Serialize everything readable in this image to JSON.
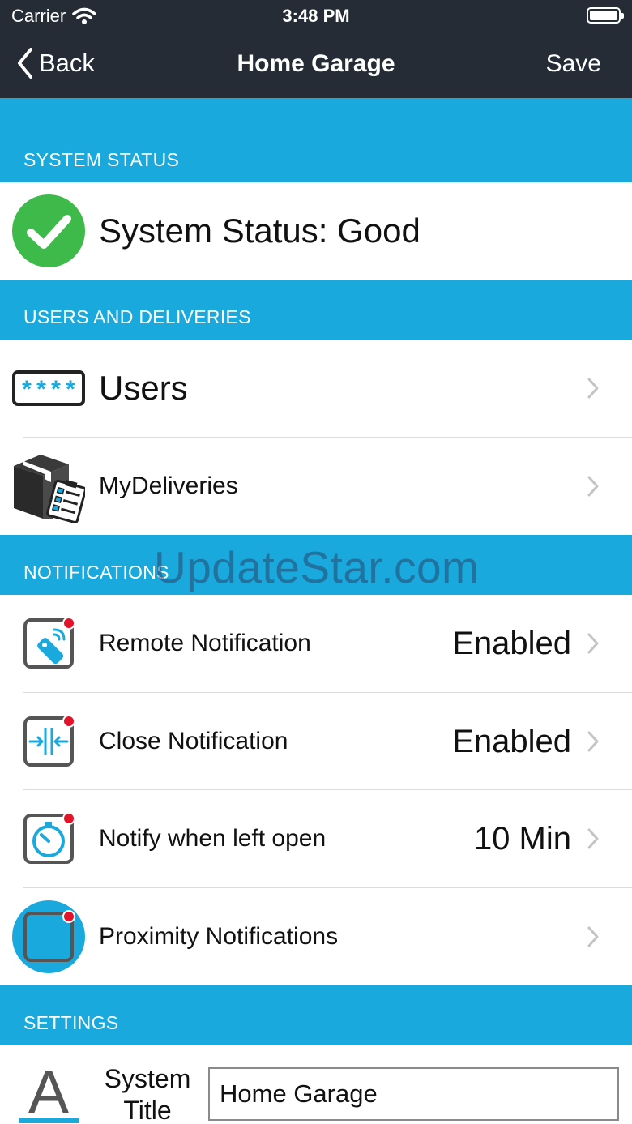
{
  "status_bar": {
    "carrier": "Carrier",
    "time": "3:48 PM"
  },
  "nav": {
    "back_label": "Back",
    "title": "Home Garage",
    "save_label": "Save"
  },
  "sections": {
    "system_status": "SYSTEM STATUS",
    "users_deliveries": "USERS AND DELIVERIES",
    "notifications": "NOTIFICATIONS",
    "settings": "SETTINGS"
  },
  "system_status": {
    "label": "System Status: Good"
  },
  "users": {
    "label": "Users",
    "icon_text": "****"
  },
  "deliveries": {
    "label": "MyDeliveries"
  },
  "notifications": [
    {
      "label": "Remote Notification",
      "value": "Enabled"
    },
    {
      "label": "Close Notification",
      "value": "Enabled"
    },
    {
      "label": "Notify when left open",
      "value": "10 Min"
    },
    {
      "label": "Proximity Notifications",
      "value": ""
    }
  ],
  "settings": {
    "icon_letter": "A",
    "system_title_label": "System Title",
    "system_title_value": "Home Garage"
  },
  "watermark": "UpdateStar.com",
  "colors": {
    "nav_bg": "#262c36",
    "accent": "#1aa9dc",
    "status_good": "#3dba4a",
    "badge_red": "#e3142a"
  }
}
